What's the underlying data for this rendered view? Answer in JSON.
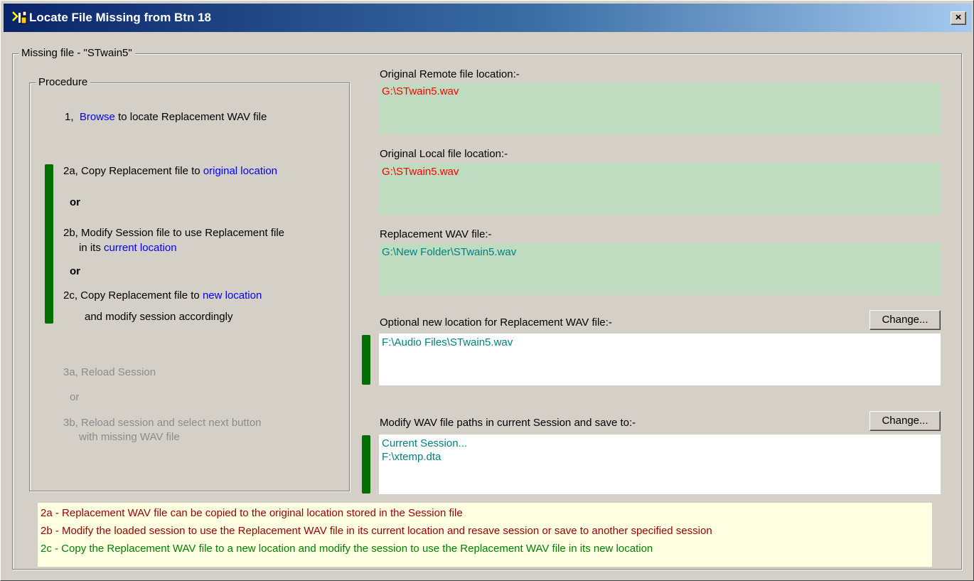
{
  "window": {
    "title": "Locate File Missing from Btn 18",
    "close_label": "×"
  },
  "missing_group": {
    "label": "Missing file - \"STwain5\""
  },
  "procedure": {
    "label": "Procedure",
    "step1_prefix": "1,",
    "step1_link": "Browse",
    "step1_suffix": "to locate Replacement WAV file",
    "step2a_text": "2a, Copy Replacement file to",
    "step2a_link": "original location",
    "or1": "or",
    "step2b_line1": "2b, Modify Session file to use Replacement file",
    "step2b_line2_prefix": "in its",
    "step2b_link": "current location",
    "or2": "or",
    "step2c_text": "2c, Copy Replacement file to",
    "step2c_link": "new location",
    "step2c_line2": "and modify session accordingly",
    "step3a": "3a, Reload Session",
    "or3": "or",
    "step3b_line1": "3b, Reload session and select next button",
    "step3b_line2": "with missing WAV file"
  },
  "fields": {
    "remote_label": "Original Remote file location:-",
    "remote_value": "G:\\STwain5.wav",
    "local_label": "Original Local file location:-",
    "local_value": "G:\\STwain5.wav",
    "replacement_label": "Replacement WAV file:-",
    "replacement_value": "G:\\New Folder\\STwain5.wav",
    "newloc_label": "Optional new location for Replacement WAV file:-",
    "newloc_value": "F:\\Audio Files\\STwain5.wav",
    "modify_label": "Modify WAV file paths in current Session and save to:-",
    "modify_value_line1": "Current Session...",
    "modify_value_line2": "F:\\xtemp.dta",
    "change_label": "Change..."
  },
  "notes": {
    "line_2a": "2a - Replacement WAV file can be copied to the original location stored in the Session file",
    "line_2b": "2b - Modify the loaded session to use the Replacement WAV file in its current location and resave session or save to another specified session",
    "line_2c": "2c - Copy the Replacement WAV file to a new location and modify the session to use the Replacement WAV file in its new location"
  },
  "colors": {
    "title_bar": "#0a246a",
    "link": "#0000ff",
    "field_green": "#c0dcc0",
    "bar_green": "#006f00",
    "notes_bg": "#ffffe1"
  }
}
